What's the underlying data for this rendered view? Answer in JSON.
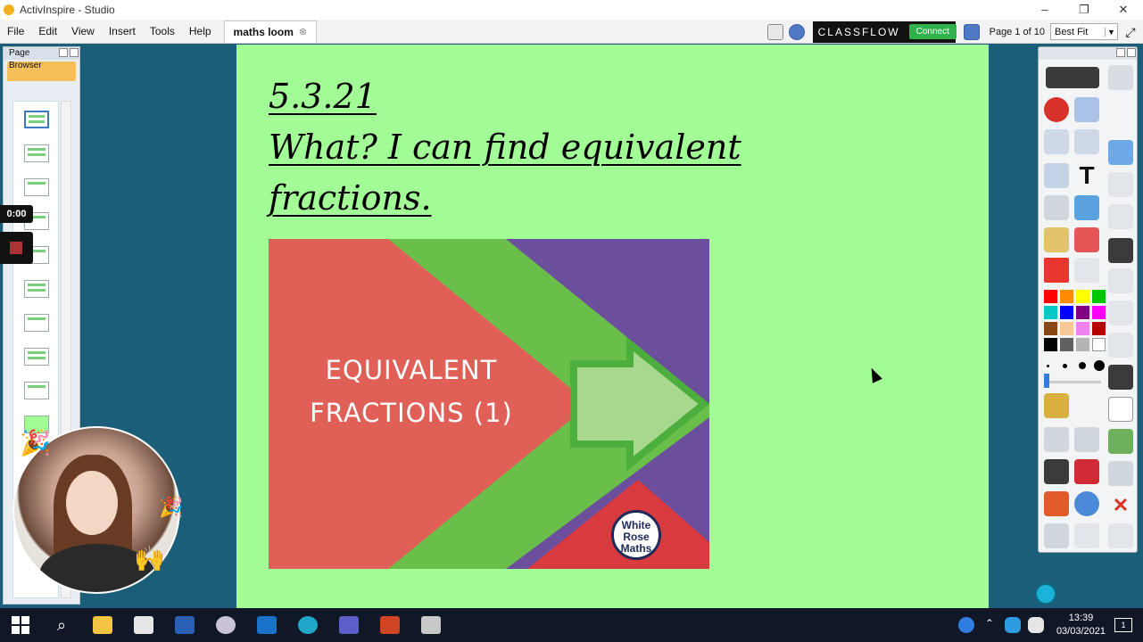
{
  "window": {
    "title": "ActivInspire - Studio"
  },
  "menu": {
    "items": [
      "File",
      "Edit",
      "View",
      "Insert",
      "Tools",
      "Help"
    ]
  },
  "doc_tab": {
    "label": "maths loom"
  },
  "classflow": {
    "brand": "CLASSFLOW",
    "connect_label": "Connect"
  },
  "page_nav": {
    "page_label": "Page 1 of 10",
    "zoom": "Best Fit"
  },
  "page_browser": {
    "title": "Page Browser"
  },
  "recording": {
    "elapsed": "0:00"
  },
  "slide": {
    "date_line": "5.3.21",
    "title_line": "What? I can find equivalent fractions.",
    "image": {
      "line1": "EQUIVALENT",
      "line2": "FRACTIONS (1)",
      "logo_line1": "White",
      "logo_line2": "Rose",
      "logo_line3": "Maths"
    }
  },
  "toolbox": {
    "palette": [
      "#ff0000",
      "#ff8c00",
      "#ffff00",
      "#00c800",
      "#00c8c8",
      "#0000ff",
      "#800080",
      "#ff00ff",
      "#8b4513",
      "#f5c896",
      "#ee82ee",
      "#b40000",
      "#000000",
      "#606060",
      "#b4b4b4",
      "#ffffff"
    ]
  },
  "taskbar": {
    "time": "13:39",
    "date": "03/03/2021"
  }
}
